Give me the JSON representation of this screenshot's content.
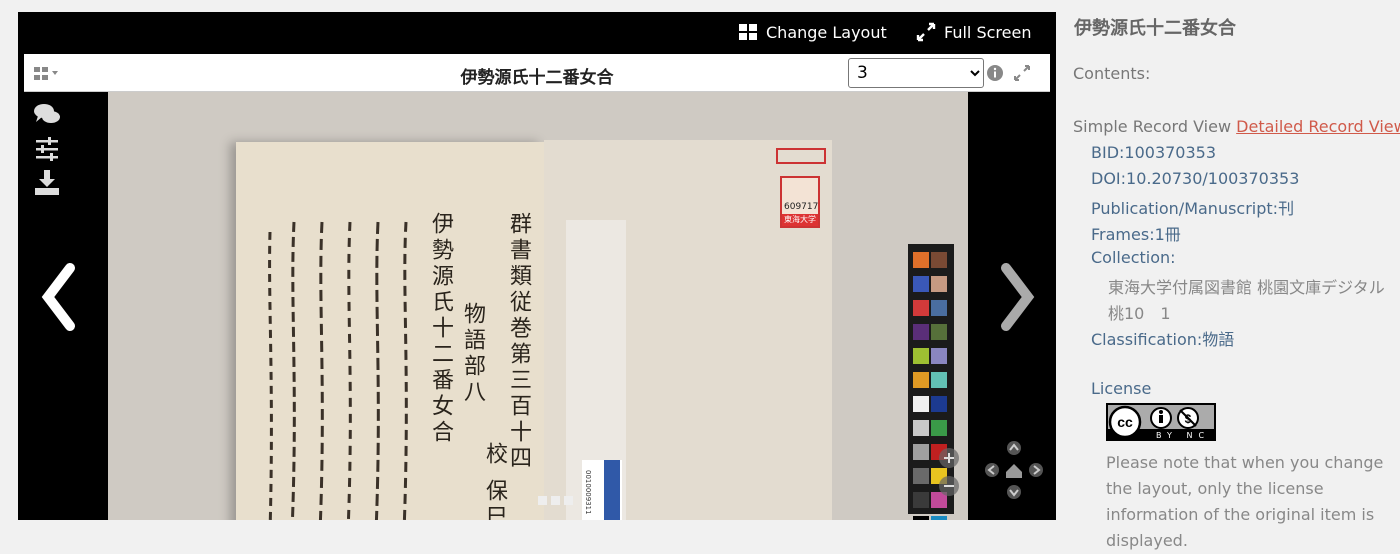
{
  "viewer": {
    "change_layout": "Change Layout",
    "full_screen": "Full Screen",
    "title": "伊勢源氏十二番女合",
    "page_select": {
      "selected": "3",
      "options": [
        "3"
      ]
    },
    "vertical_text_col1": "群書類従巻第三百十四",
    "vertical_text_col2": "物語部八",
    "vertical_text_col3": "伊勢源氏十二番女合",
    "vertical_text_col4": "校 保巳",
    "stamp_number": "609717",
    "stamp_org": "東海大学",
    "barcode_number": "0010009311"
  },
  "sidebar": {
    "title": "伊勢源氏十二番女合",
    "contents_label": "Contents:",
    "simple_record_view": "Simple Record View",
    "detailed_record_view": "Detailed Record View",
    "bid": "BID:100370353",
    "doi": "DOI:10.20730/100370353",
    "publication": "Publication/Manuscript:刊",
    "frames": "Frames:1冊",
    "collection_label": "Collection:",
    "collection_value1": "東海大学付属図書館 桃園文庫デジタル",
    "collection_value2": "桃10　1",
    "classification": "Classification:物語",
    "license_label": "License",
    "license_badge": "BY NC",
    "note": "Please note that when you change the layout, only the license information of the original item is displayed."
  },
  "colors": {
    "accent_link": "#d05a4a",
    "meta_blue": "#4a6a8a",
    "viewer_bg": "#000000"
  }
}
